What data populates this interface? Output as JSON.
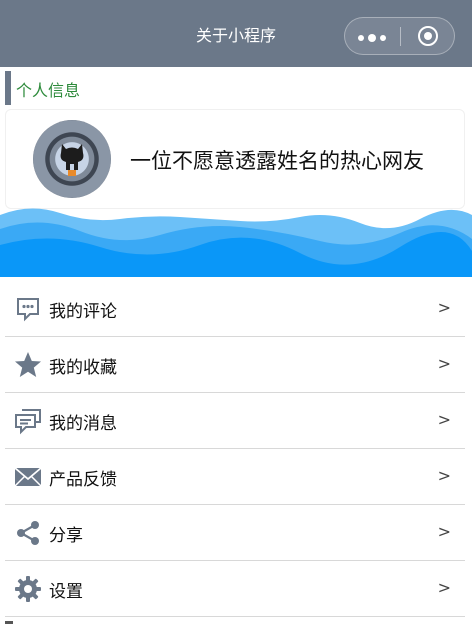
{
  "navbar": {
    "title": "关于小程序",
    "capsule_icons": [
      "more-dots-icon",
      "close-target-icon"
    ]
  },
  "section": {
    "title": "个人信息"
  },
  "profile": {
    "name": "一位不愿意透露姓名的热心网友"
  },
  "menu": {
    "items": [
      {
        "label": "我的评论",
        "icon": "comment-icon",
        "arrow": ">"
      },
      {
        "label": "我的收藏",
        "icon": "star-icon",
        "arrow": ">"
      },
      {
        "label": "我的消息",
        "icon": "message-icon",
        "arrow": ">"
      },
      {
        "label": "产品反馈",
        "icon": "envelope-icon",
        "arrow": ">"
      },
      {
        "label": "分享",
        "icon": "share-icon",
        "arrow": ">"
      },
      {
        "label": "设置",
        "icon": "gear-icon",
        "arrow": ">"
      }
    ]
  },
  "colors": {
    "navbar": "#6b7889",
    "section_title": "#2e8b3c",
    "wave_dark": "#0a97f8",
    "wave_light": "#6cc0f7",
    "icon": "#6b7889"
  }
}
